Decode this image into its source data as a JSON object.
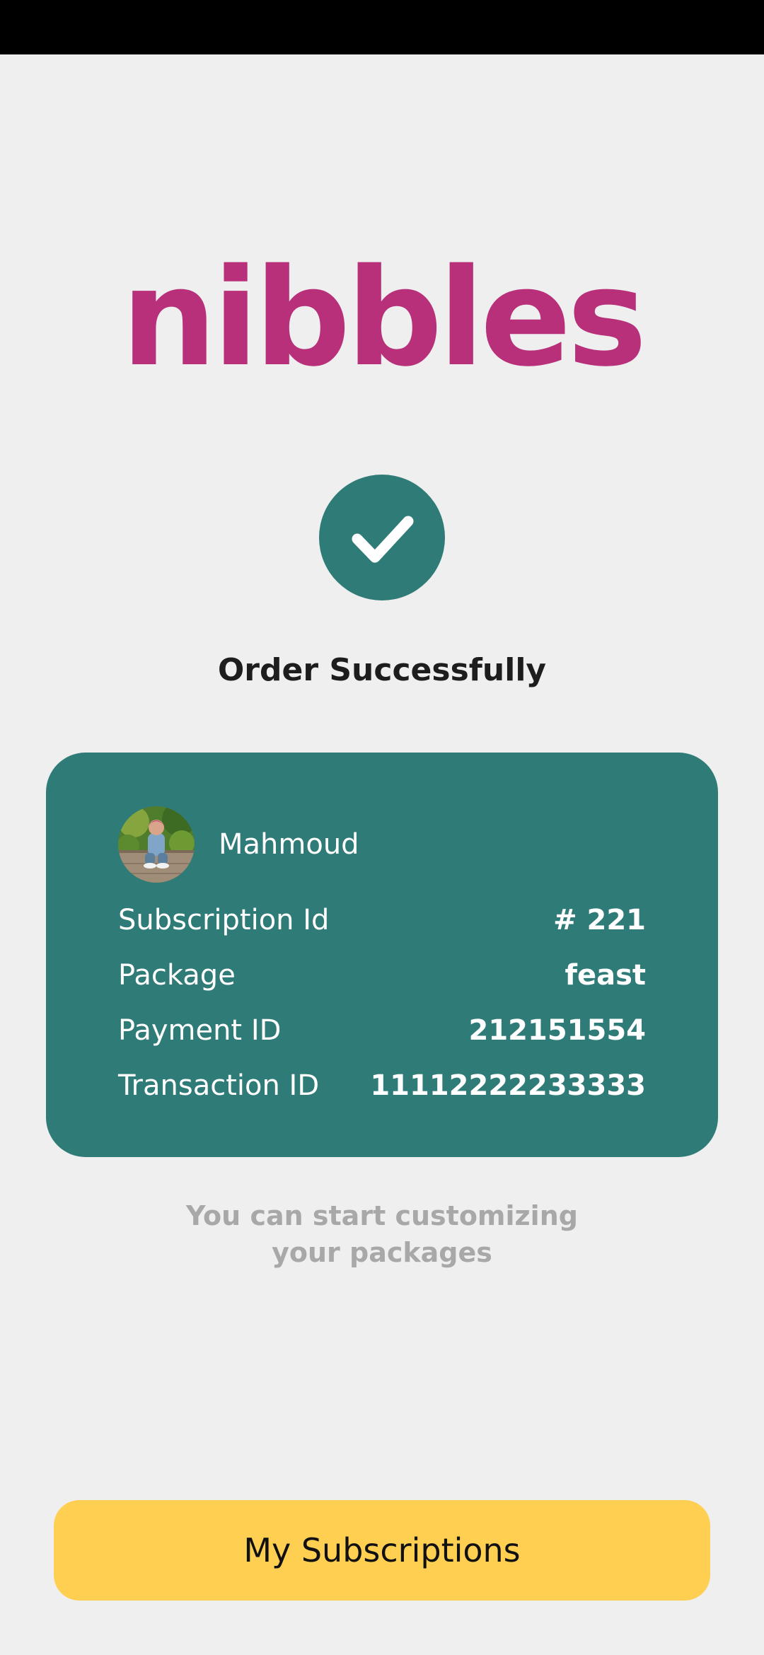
{
  "brand": {
    "logo_text": "nibbles",
    "logo_color": "#b8307a"
  },
  "status": {
    "icon": "check-icon",
    "title": "Order Successfully",
    "accent": "#2f7b78"
  },
  "card": {
    "user_name": "Mahmoud",
    "rows": [
      {
        "label": "Subscription Id",
        "value": "# 221"
      },
      {
        "label": "Package",
        "value": "feast"
      },
      {
        "label": "Payment ID",
        "value": "212151554"
      },
      {
        "label": "Transaction ID",
        "value": "11112222233333"
      }
    ]
  },
  "hint": {
    "line1": "You can start customizing",
    "line2": "your packages"
  },
  "cta": {
    "label": "My Subscriptions",
    "color": "#ffcf52"
  }
}
